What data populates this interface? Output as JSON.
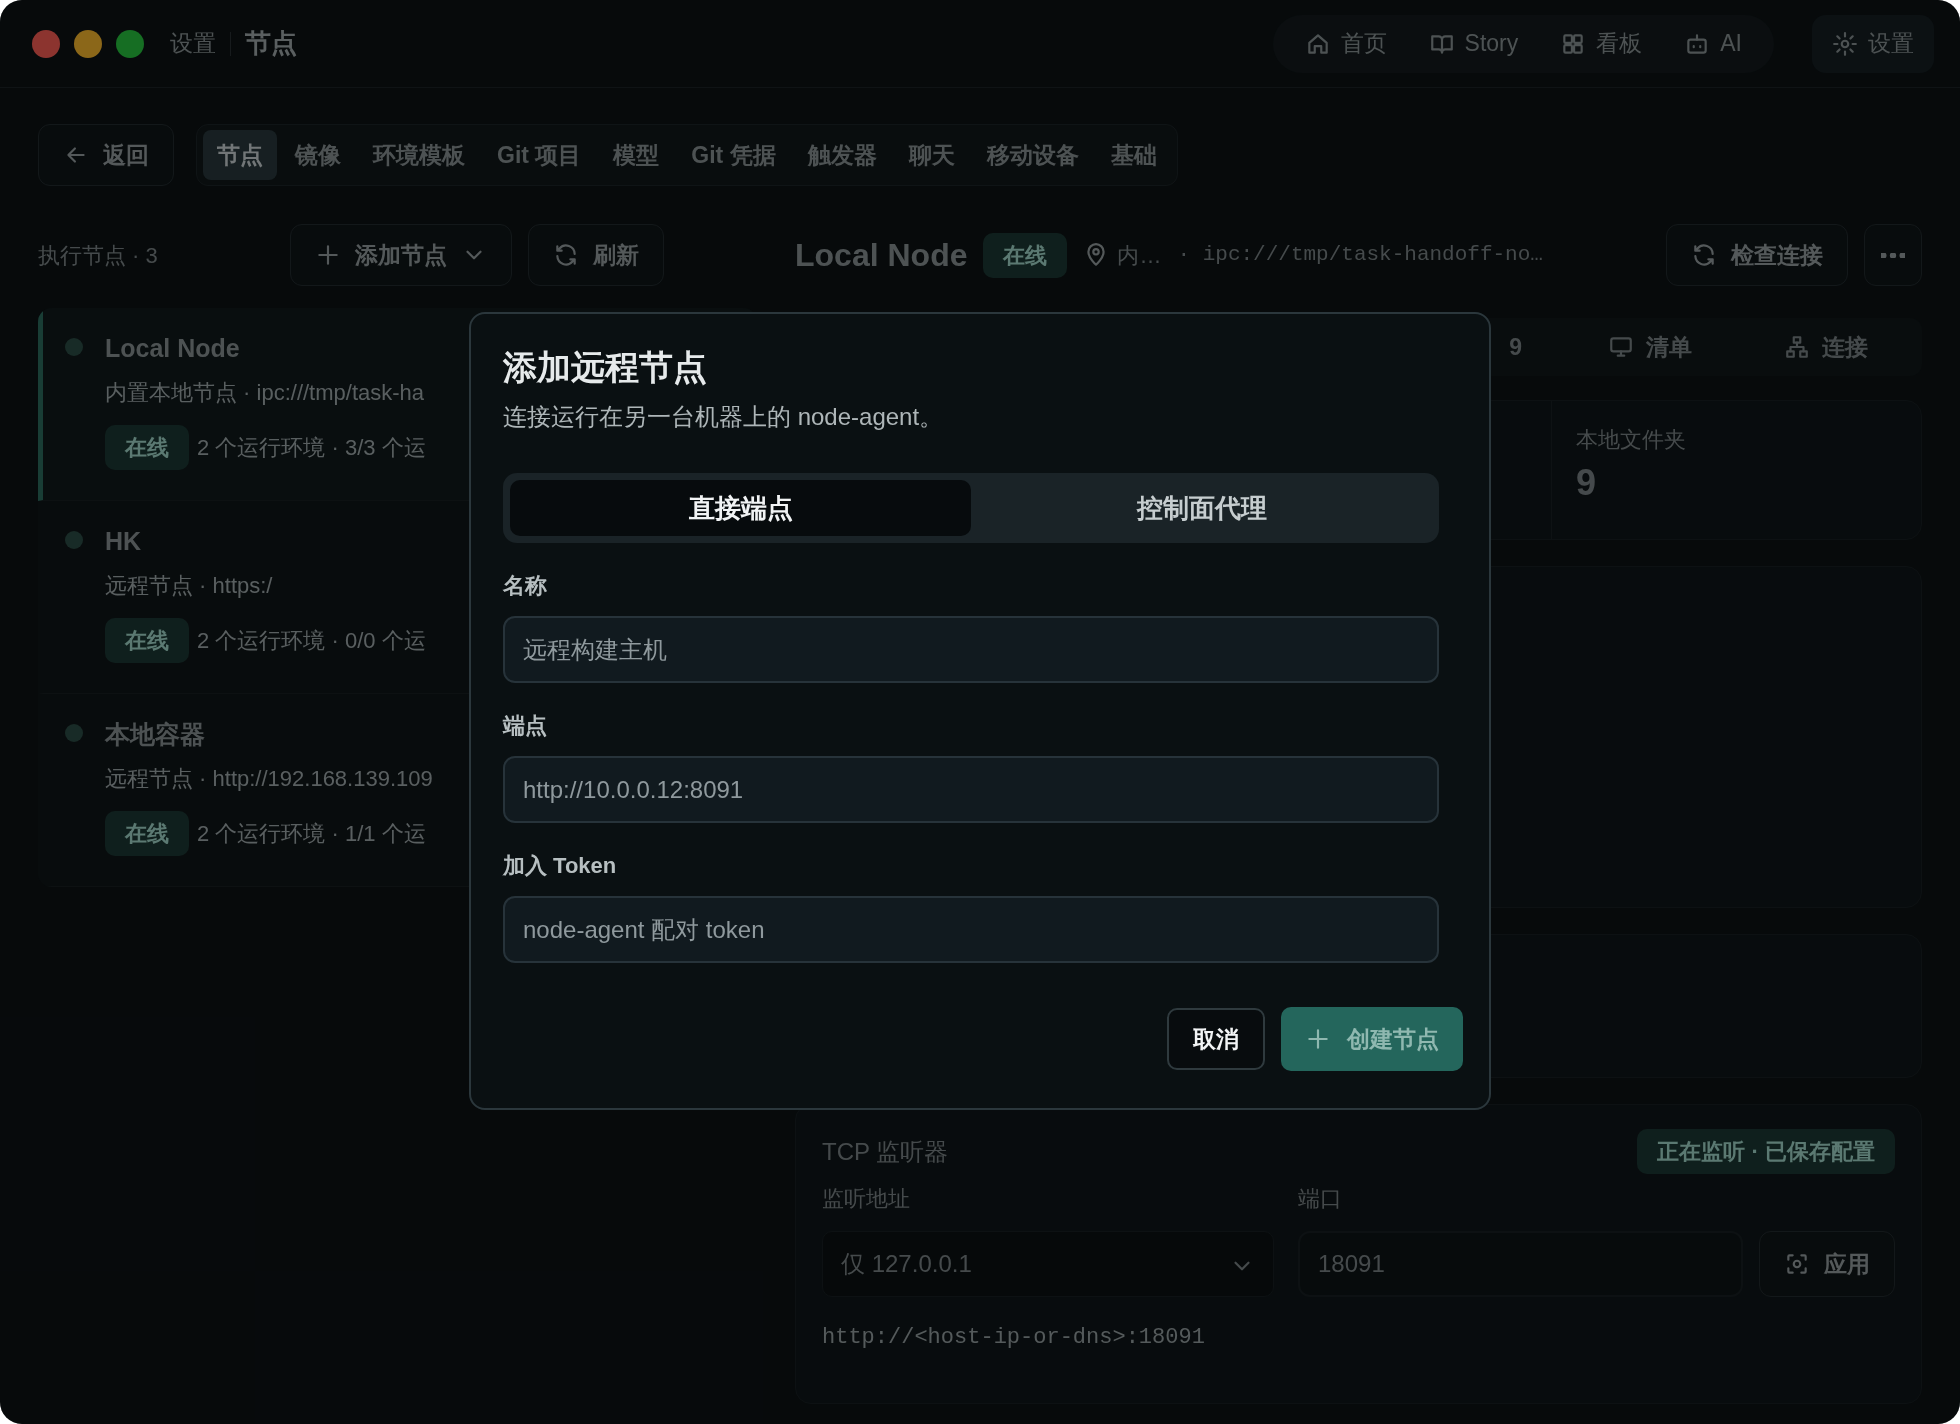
{
  "window": {
    "parent": "设置",
    "title": "节点"
  },
  "top_nav": [
    {
      "label": "首页"
    },
    {
      "label": "Story"
    },
    {
      "label": "看板"
    },
    {
      "label": "AI"
    }
  ],
  "settings_button": "设置",
  "back_button": "返回",
  "tabs": [
    {
      "label": "节点",
      "selected": true
    },
    {
      "label": "镜像",
      "selected": false
    },
    {
      "label": "环境模板",
      "selected": false
    },
    {
      "label": "Git 项目",
      "selected": false
    },
    {
      "label": "模型",
      "selected": false
    },
    {
      "label": "Git 凭据",
      "selected": false
    },
    {
      "label": "触发器",
      "selected": false
    },
    {
      "label": "聊天",
      "selected": false
    },
    {
      "label": "移动设备",
      "selected": false
    },
    {
      "label": "基础",
      "selected": false
    }
  ],
  "sidebar": {
    "heading": "执行节点 · 3",
    "add_button": "添加节点",
    "refresh_button": "刷新",
    "items": [
      {
        "name": "Local Node",
        "detail": "内置本地节点 · ipc:///tmp/task-ha",
        "status": "在线",
        "summary": "2 个运行环境 · 3/3 个运",
        "selected": true
      },
      {
        "name": "HK",
        "detail": "远程节点 · https:/",
        "status": "在线",
        "summary": "2 个运行环境 · 0/0 个运",
        "selected": false
      },
      {
        "name": "本地容器",
        "detail": "远程节点 · http://192.168.139.109",
        "status": "在线",
        "summary": "2 个运行环境 · 1/1 个运",
        "selected": false
      }
    ]
  },
  "detail": {
    "name": "Local Node",
    "status": "在线",
    "location": "内…",
    "address": "· ipc:///tmp/task-handoff-no…",
    "check_button": "检查连接",
    "tabs": [
      {
        "label": "9"
      },
      {
        "label": "清单"
      },
      {
        "label": "连接"
      }
    ],
    "stat": {
      "label": "本地文件夹",
      "value": "9"
    },
    "tcp": {
      "title": "TCP 监听器",
      "badge": "正在监听 · 已保存配置",
      "address_label": "监听地址",
      "address_value": "仅 127.0.0.1",
      "port_label": "端口",
      "port_value": "18091",
      "apply_button": "应用",
      "hint": "http://<host-ip-or-dns>:18091"
    }
  },
  "modal": {
    "title": "添加远程节点",
    "subtitle": "连接运行在另一台机器上的 node-agent。",
    "modes": [
      {
        "label": "直接端点",
        "selected": true
      },
      {
        "label": "控制面代理",
        "selected": false
      }
    ],
    "fields": [
      {
        "label": "名称",
        "placeholder": "远程构建主机"
      },
      {
        "label": "端点",
        "placeholder": "http://10.0.0.12:8091"
      },
      {
        "label": "加入 Token",
        "placeholder": "node-agent 配对 token"
      }
    ],
    "cancel_button": "取消",
    "submit_button": {
      "label": "创建节点",
      "disabled": true
    }
  }
}
